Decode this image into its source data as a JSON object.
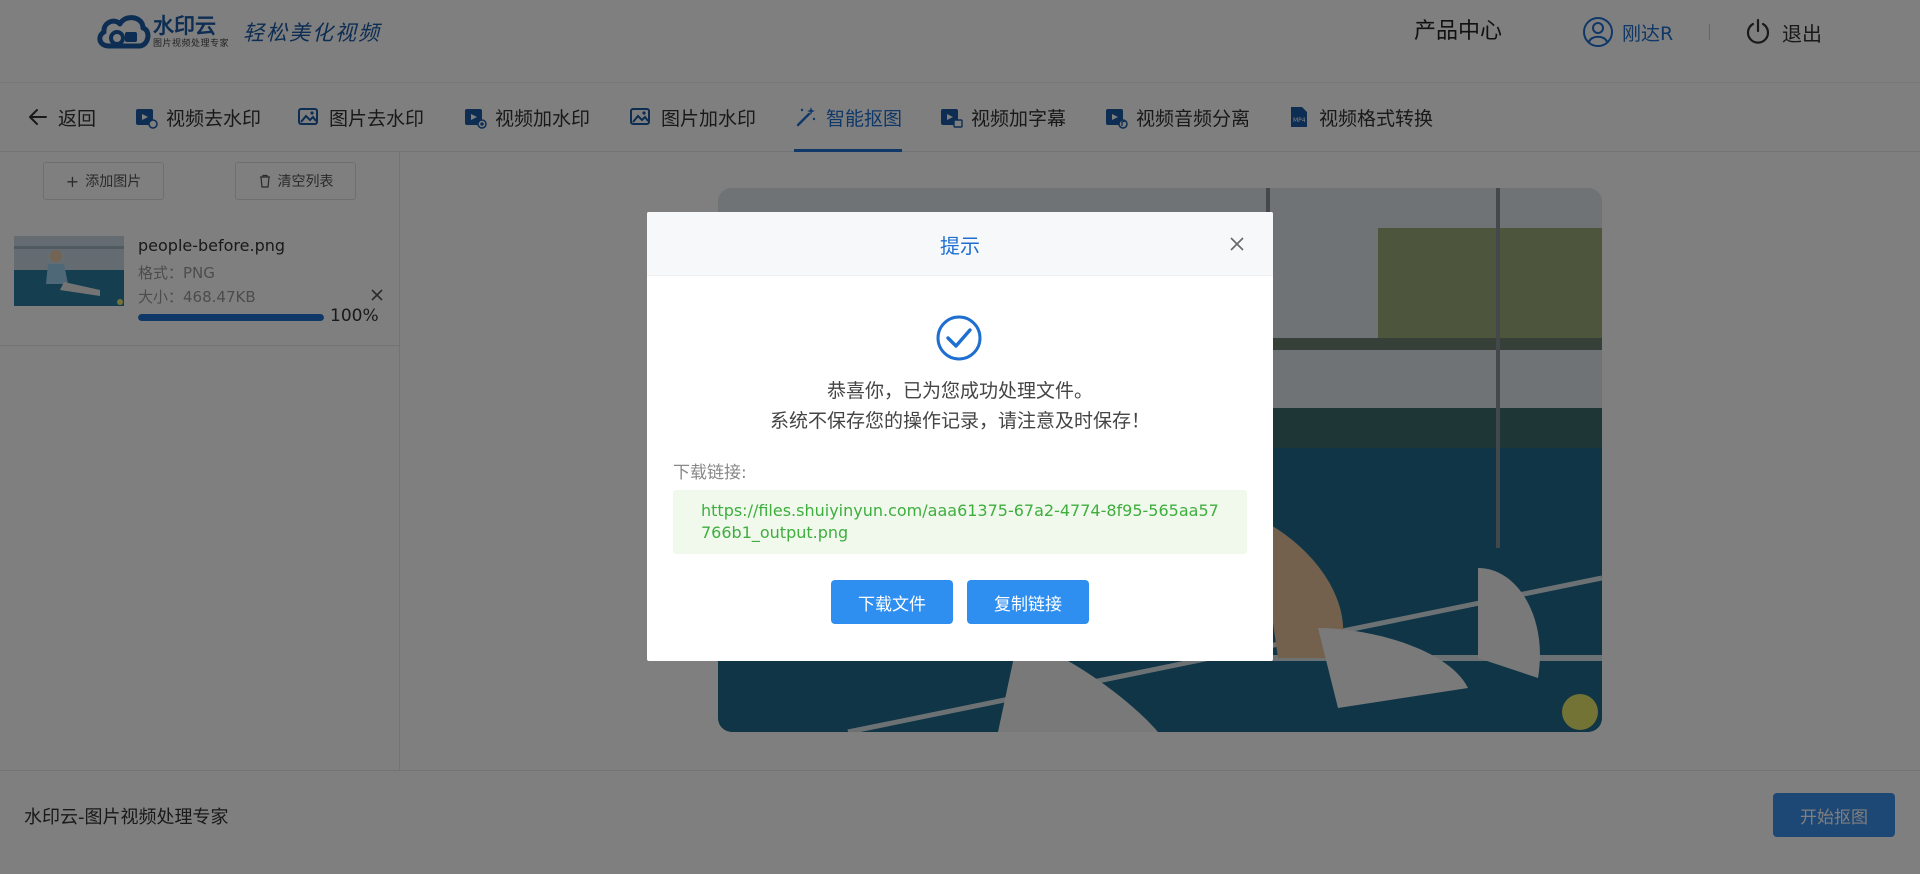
{
  "header": {
    "logo_name": "水印云",
    "logo_sub": "图片视频处理专家",
    "slogan": "轻松美化视频",
    "product_center": "产品中心",
    "user_name": "刚达R",
    "logout": "退出"
  },
  "nav": {
    "back": "返回",
    "items": [
      {
        "label": "视频去水印",
        "icon": "video-remove-watermark-icon"
      },
      {
        "label": "图片去水印",
        "icon": "image-remove-watermark-icon"
      },
      {
        "label": "视频加水印",
        "icon": "video-add-watermark-icon"
      },
      {
        "label": "图片加水印",
        "icon": "image-add-watermark-icon"
      },
      {
        "label": "智能抠图",
        "icon": "magic-wand-icon",
        "active": true
      },
      {
        "label": "视频加字幕",
        "icon": "video-subtitle-icon"
      },
      {
        "label": "视频音频分离",
        "icon": "audio-separate-icon"
      },
      {
        "label": "视频格式转换",
        "icon": "mp4-format-icon"
      }
    ]
  },
  "sidebar": {
    "add_image": "添加图片",
    "clear_list": "清空列表",
    "file": {
      "name": "people-before.png",
      "format": "格式：PNG",
      "size": "大小：468.47KB",
      "progress": 100,
      "progress_text": "100%"
    }
  },
  "footer": {
    "text": "水印云-图片视频处理专家",
    "start_button": "开始抠图"
  },
  "modal": {
    "title": "提示",
    "message_line1": "恭喜你，已为您成功处理文件。",
    "message_line2": "系统不保存您的操作记录，请注意及时保存！",
    "download_label": "下载链接:",
    "download_url": "https://files.shuiyinyun.com/aaa61375-67a2-4774-8f95-565aa57766b1_output.png",
    "download_button": "下载文件",
    "copy_button": "复制链接"
  },
  "colors": {
    "accent": "#1e6fd0",
    "button": "#2f8ff0",
    "link_green": "#3fae3f",
    "link_bg": "#f0f9eb"
  }
}
